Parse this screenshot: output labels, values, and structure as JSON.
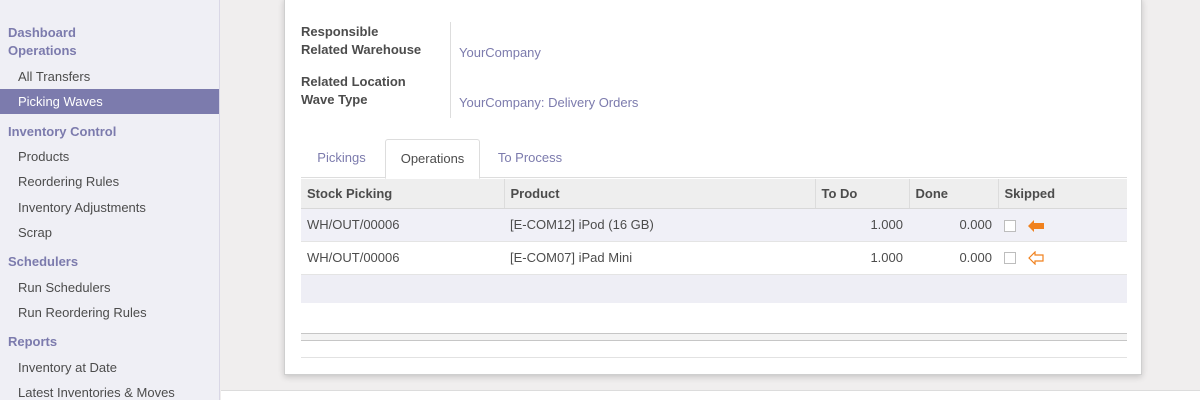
{
  "sidebar": {
    "sections": [
      {
        "header": [
          "Dashboard",
          "Operations"
        ],
        "items": [
          "All Transfers",
          "Picking Waves"
        ]
      },
      {
        "header": [
          "Inventory Control"
        ],
        "items": [
          "Products",
          "Reordering Rules",
          "Inventory Adjustments",
          "Scrap"
        ]
      },
      {
        "header": [
          "Schedulers"
        ],
        "items": [
          "Run Schedulers",
          "Run Reordering Rules"
        ]
      },
      {
        "header": [
          "Reports"
        ],
        "items": [
          "Inventory at Date",
          "Latest Inventories & Moves"
        ]
      }
    ],
    "active_item": "Picking Waves"
  },
  "form": {
    "label_responsible": "Responsible",
    "label_related_warehouse": "Related Warehouse",
    "value_related_warehouse": "YourCompany",
    "label_related_location": "Related Location",
    "label_wave_type": "Wave Type",
    "value_wave_type": "YourCompany: Delivery Orders"
  },
  "tabs": {
    "pickings": "Pickings",
    "operations": "Operations",
    "to_process": "To Process",
    "active": "Operations"
  },
  "table": {
    "headers": {
      "stock_picking": "Stock Picking",
      "product": "Product",
      "to_do": "To Do",
      "done": "Done",
      "skipped": "Skipped"
    },
    "rows": [
      {
        "stock_picking": "WH/OUT/00006",
        "product": "[E-COM12] iPod (16 GB)",
        "to_do": "1.000",
        "done": "0.000",
        "skipped_icon": "arrow-left-filled-icon"
      },
      {
        "stock_picking": "WH/OUT/00006",
        "product": "[E-COM07] iPad Mini",
        "to_do": "1.000",
        "done": "0.000",
        "skipped_icon": "arrow-left-outline-icon"
      }
    ]
  },
  "colors": {
    "accent": "#7c7bad",
    "arrow": "#f0811e"
  }
}
